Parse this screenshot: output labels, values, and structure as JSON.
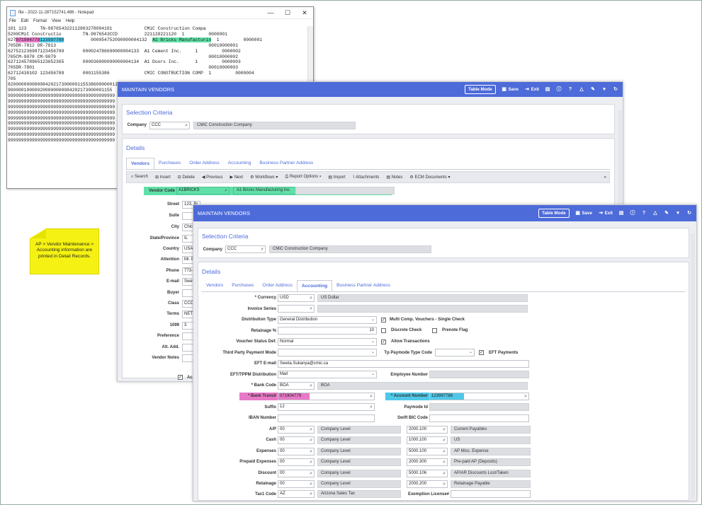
{
  "notepad": {
    "title": "file - 2022-11-28T152741.486 - Notepad",
    "menu": [
      "File",
      "Edit",
      "Format",
      "View",
      "Help"
    ],
    "window_controls": [
      "—",
      "☐",
      "✕"
    ],
    "lines": [
      "101 123     TN-987654322112803278094101            CMiC Construction Compa",
      "5200CMiC Constructio        TN-9876543CCD          221128221120  1         0000001",
      "627",
      "705DR-7812 DR-7813                                                         00010000001",
      "627521236987123456789       000024786690000004133  A1 Cement Inc.     1         0000002",
      "705CM-9078 CM-9079                                                         00010000002",
      "627124578965123652365       000036000090000004134  A1 Doors Inc.      1         0000003",
      "705DR-7801                                                                 00010000003",
      "62712430102 123456789       0001155386             CMIC CONSTRUCTION COMP  1         0000004",
      "705",
      "820000000080084202173000001155386000000115",
      "900000100000200000000084202173000001155",
      "9999999999999999999999999999999999999999",
      "9999999999999999999999999999999999999999",
      "9999999999999999999999999999999999999999",
      "9999999999999999999999999999999999999999",
      "9999999999999999999999999999999999999999",
      "9999999999999999999999999999999999999999",
      "9999999999999999999999999999999999999999",
      "9999999999999999999999999999999999999999",
      "9999999999999999999999999999999999999999"
    ],
    "line3": {
      "prefix": "627",
      "transit": "071904779",
      "account": "123997788",
      "mid": "          000054752090000004132  ",
      "vendor": "A1 Bricks Manufacturin",
      "suffix": "  1         0000001"
    },
    "line10_tail": "000000"
  },
  "note": {
    "text": "AP > Vendor Maintenance > Accounting information are printed in Detail Records."
  },
  "back": {
    "title": "MAINTAIN VENDORS",
    "tools": {
      "table_mode": "Table Mode",
      "save": "Save",
      "exit": "Exit"
    },
    "selection_title": "Selection Criteria",
    "company_label": "Company",
    "company_code": "CCC",
    "company_name": "CMiC Construction Company",
    "details_title": "Details",
    "tabs": [
      "Vendors",
      "Purchases",
      "Order Address",
      "Accounting",
      "Business Partner Address"
    ],
    "toolbar": [
      "Search",
      "Insert",
      "Delete",
      "Previous",
      "Next",
      "Workflows",
      "Report Options",
      "Import",
      "Attachments",
      "Notes",
      "ECM Documents"
    ],
    "vendor_code_label": "Vendor Code",
    "vendor_code": "A1BRICKS",
    "vendor_name": "A1 Bricks Manufacturing Inc.",
    "fields": [
      {
        "label": "Street",
        "value": "123, Br"
      },
      {
        "label": "Suite",
        "value": ""
      },
      {
        "label": "City",
        "value": "Chicag"
      },
      {
        "label": "State/Province",
        "value": "IL"
      },
      {
        "label": "Country",
        "value": "USA"
      },
      {
        "label": "Attention",
        "value": "Mr. Bric"
      },
      {
        "label": "Phone",
        "value": "773-222"
      },
      {
        "label": "E-mail",
        "value": "Sweta.S"
      },
      {
        "label": "Buyer",
        "value": ""
      },
      {
        "label": "Class",
        "value": "CCC1"
      },
      {
        "label": "Terms",
        "value": "NET30"
      },
      {
        "label": "1099",
        "value": "3"
      },
      {
        "label": "Preference",
        "value": ""
      },
      {
        "label": "Alt. Add.",
        "value": ""
      },
      {
        "label": "Vendor Notes",
        "value": ""
      }
    ],
    "ac_label": "Ac"
  },
  "front": {
    "title": "MAINTAIN VENDORS",
    "tools": {
      "table_mode": "Table Mode",
      "save": "Save",
      "exit": "Exit"
    },
    "selection_title": "Selection Criteria",
    "company_label": "Company",
    "company_code": "CCC",
    "company_name": "CMiC Construction Company",
    "details_title": "Details",
    "tabs": [
      "Vendors",
      "Purchases",
      "Order Address",
      "Accounting",
      "Business Partner Address"
    ],
    "currency_label": "* Currency",
    "currency": "USD",
    "currency_name": "US Dollar",
    "invoice_series_label": "Invoice Series",
    "dist_type_label": "Distribution Type",
    "dist_type": "General Distribution",
    "multi_comp": "Multi Comp. Vouchers - Single Check",
    "retainage_pct_label": "Retainage %",
    "retainage_pct": "10",
    "discrete_check": "Discrete Check",
    "prenote_flag": "Prenote Flag",
    "voucher_status_label": "Voucher Status Def.",
    "voucher_status": "Normal",
    "allow_transactions": "Allow Transactions",
    "tpp_mode_label": "Third Party Payment Mode",
    "tp_paymode_label": "Tp Paymode Type Code",
    "eft_payments": "EFT Payments",
    "eft_email_label": "EFT E-mail",
    "eft_email": "Sweta.Sukanya@cmic.ca",
    "eft_dist_label": "EFT/TPPM Distribution",
    "eft_dist": "Mail",
    "employee_number_label": "Employee Number",
    "bank_code_label": "* Bank Code",
    "bank_code": "BOA",
    "bank_name": "BOA",
    "bank_transit_label": "* Bank Transit",
    "bank_transit": "071904779",
    "account_number_label": "* Account Number",
    "account_number": "123997788",
    "suffix_label": "Suffix",
    "suffix": "12",
    "paymode_id_label": "Paymode Id",
    "iban_label": "IBAN Number",
    "swift_label": "Swift BIC Code",
    "gl_rows": [
      {
        "label": "A/P",
        "dept": "00",
        "level": "Company Level",
        "acct": "2000.100",
        "desc": "Current Payables"
      },
      {
        "label": "Cash",
        "dept": "00",
        "level": "Company Level",
        "acct": "1000.100",
        "desc": "US"
      },
      {
        "label": "Expenses",
        "dept": "00",
        "level": "Company Level",
        "acct": "5000.100",
        "desc": "AP Misc. Expense"
      },
      {
        "label": "Prepaid Expenses",
        "dept": "00",
        "level": "Company Level",
        "acct": "2000.300",
        "desc": "Pre-paid AP (Deposits)"
      },
      {
        "label": "Discount",
        "dept": "00",
        "level": "Company Level",
        "acct": "5000.106",
        "desc": "AP/AR Discounts Lost/Taken"
      },
      {
        "label": "Retainage",
        "dept": "00",
        "level": "Company Level",
        "acct": "2000.200",
        "desc": "Retainage Payable"
      }
    ],
    "tax_label": "Tax1 Code",
    "tax_code": "AZ",
    "tax_name": "Arizona Sales Tax",
    "exemption_label": "Exemption License#"
  },
  "colors": {
    "header": "#4d6bd9",
    "pink": "#e879c8",
    "blue": "#4ec8e8",
    "green": "#5fe0a8",
    "note": "#f5f213"
  }
}
